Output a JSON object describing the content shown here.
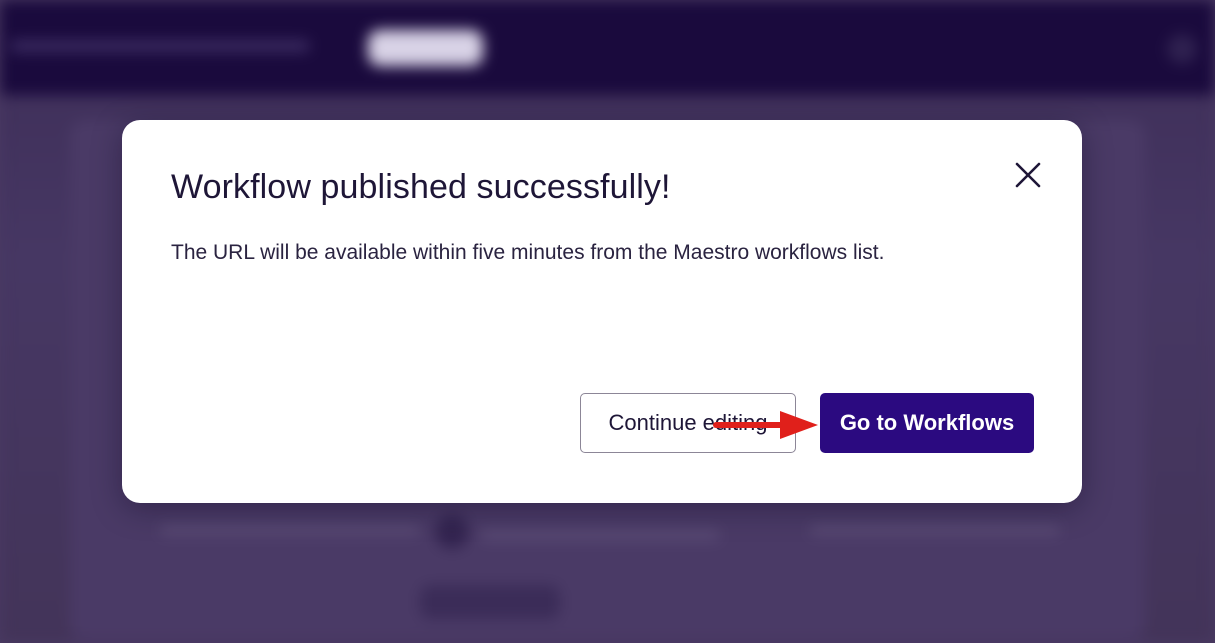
{
  "dialog": {
    "title": "Workflow published successfully!",
    "message": "The URL will be available within five minutes from the Maestro workflows list.",
    "secondary_button_label": "Continue editing",
    "primary_button_label": "Go to Workflows",
    "close_icon": "close-icon"
  },
  "colors": {
    "primary_button": "#2b0a80",
    "annotation_arrow": "#e0201b",
    "overlay": "#4a3a63"
  }
}
